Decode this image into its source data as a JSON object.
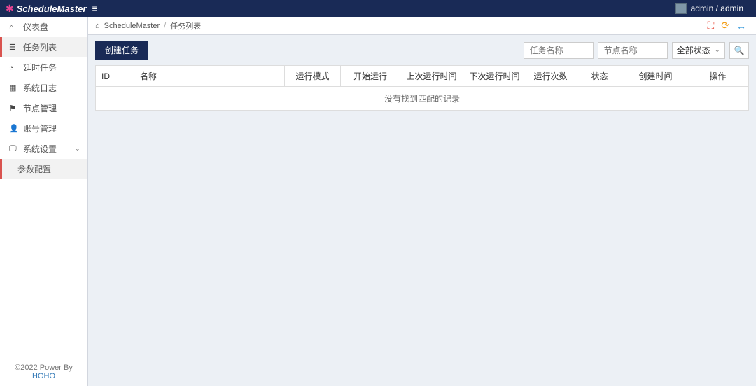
{
  "app": {
    "name": "ScheduleMaster"
  },
  "user": {
    "display": "admin / admin"
  },
  "sidebar": {
    "items": [
      {
        "icon": "home",
        "label": "仪表盘",
        "active": false
      },
      {
        "icon": "list",
        "label": "任务列表",
        "active": true
      },
      {
        "icon": "clock",
        "label": "延时任务",
        "active": false
      },
      {
        "icon": "grid",
        "label": "系统日志",
        "active": false
      },
      {
        "icon": "sitemap",
        "label": "节点管理",
        "active": false
      },
      {
        "icon": "user",
        "label": "账号管理",
        "active": false
      },
      {
        "icon": "desktop",
        "label": "系统设置",
        "active": false,
        "expandable": true,
        "expanded": true
      }
    ],
    "submenu": [
      {
        "label": "参数配置",
        "active": true
      }
    ]
  },
  "footer": {
    "text": "©2022 Power By ",
    "link_text": "HOHO"
  },
  "breadcrumb": {
    "root": "ScheduleMaster",
    "current": "任务列表"
  },
  "actions": {
    "create_label": "创建任务"
  },
  "filters": {
    "task_name_placeholder": "任务名称",
    "node_name_placeholder": "节点名称",
    "status_selected": "全部状态"
  },
  "table": {
    "columns": [
      "ID",
      "名称",
      "运行模式",
      "开始运行",
      "上次运行时间",
      "下次运行时间",
      "运行次数",
      "状态",
      "创建时间",
      "操作"
    ],
    "empty_text": "没有找到匹配的记录"
  }
}
